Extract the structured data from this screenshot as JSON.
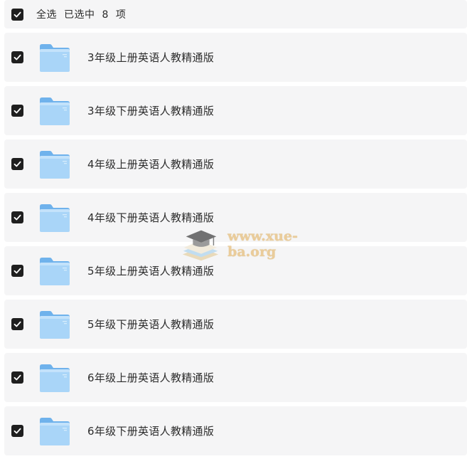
{
  "header": {
    "select_all_label": "全选",
    "selected_label": "已选中",
    "selected_count": "8",
    "unit_label": "项",
    "checked": true
  },
  "items": [
    {
      "name": "3年级上册英语人教精通版",
      "checked": true,
      "icon": "folder-icon"
    },
    {
      "name": "3年级下册英语人教精通版",
      "checked": true,
      "icon": "folder-icon"
    },
    {
      "name": "4年级上册英语人教精通版",
      "checked": true,
      "icon": "folder-icon"
    },
    {
      "name": "4年级下册英语人教精通版",
      "checked": true,
      "icon": "folder-icon"
    },
    {
      "name": "5年级上册英语人教精通版",
      "checked": true,
      "icon": "folder-icon"
    },
    {
      "name": "5年级下册英语人教精通版",
      "checked": true,
      "icon": "folder-icon"
    },
    {
      "name": "6年级上册英语人教精通版",
      "checked": true,
      "icon": "folder-icon"
    },
    {
      "name": "6年级下册英语人教精通版",
      "checked": true,
      "icon": "folder-icon"
    }
  ],
  "watermark": {
    "text": "www.xue-ba.org",
    "icon": "graduation-cap-books-icon"
  },
  "colors": {
    "row_background": "#f5f5f6",
    "checkbox": "#1f1f1f",
    "folder": "#8ec8f6",
    "watermark_text": "#e9c58a"
  }
}
